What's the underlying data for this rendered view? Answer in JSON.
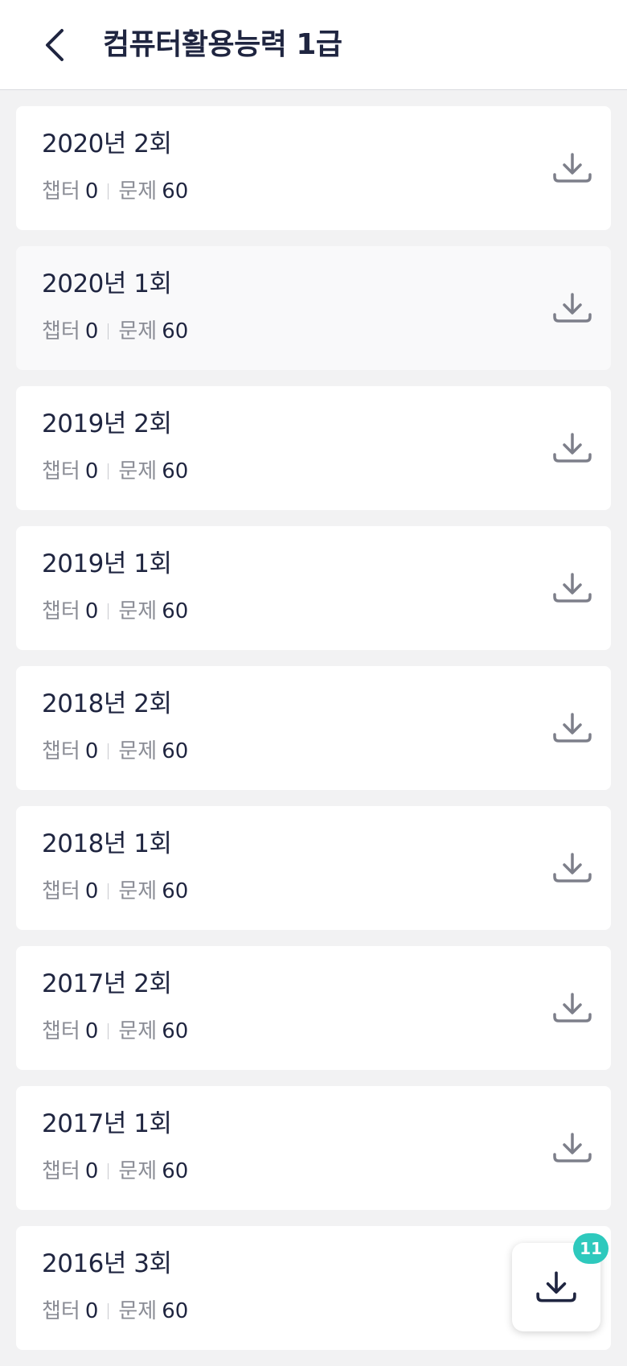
{
  "header": {
    "title": "컴퓨터활용능력 1급",
    "back_icon": "chevron-left-icon"
  },
  "exams": [
    {
      "title": "2020년 2회",
      "chapter_label": "챕터",
      "chapter_count": "0",
      "question_label": "문제",
      "question_count": "60"
    },
    {
      "title": "2020년 1회",
      "chapter_label": "챕터",
      "chapter_count": "0",
      "question_label": "문제",
      "question_count": "60"
    },
    {
      "title": "2019년 2회",
      "chapter_label": "챕터",
      "chapter_count": "0",
      "question_label": "문제",
      "question_count": "60"
    },
    {
      "title": "2019년 1회",
      "chapter_label": "챕터",
      "chapter_count": "0",
      "question_label": "문제",
      "question_count": "60"
    },
    {
      "title": "2018년 2회",
      "chapter_label": "챕터",
      "chapter_count": "0",
      "question_label": "문제",
      "question_count": "60"
    },
    {
      "title": "2018년 1회",
      "chapter_label": "챕터",
      "chapter_count": "0",
      "question_label": "문제",
      "question_count": "60"
    },
    {
      "title": "2017년 2회",
      "chapter_label": "챕터",
      "chapter_count": "0",
      "question_label": "문제",
      "question_count": "60"
    },
    {
      "title": "2017년 1회",
      "chapter_label": "챕터",
      "chapter_count": "0",
      "question_label": "문제",
      "question_count": "60"
    },
    {
      "title": "2016년 3회",
      "chapter_label": "챕터",
      "chapter_count": "0",
      "question_label": "문제",
      "question_count": "60"
    }
  ],
  "download_fab": {
    "badge_count": "11",
    "icon": "download-icon"
  },
  "colors": {
    "accent_badge": "#2ec9bd",
    "text_primary": "#1f2540",
    "text_secondary": "#8a8c95",
    "icon": "#7d7f8a",
    "background": "#f2f2f3"
  }
}
